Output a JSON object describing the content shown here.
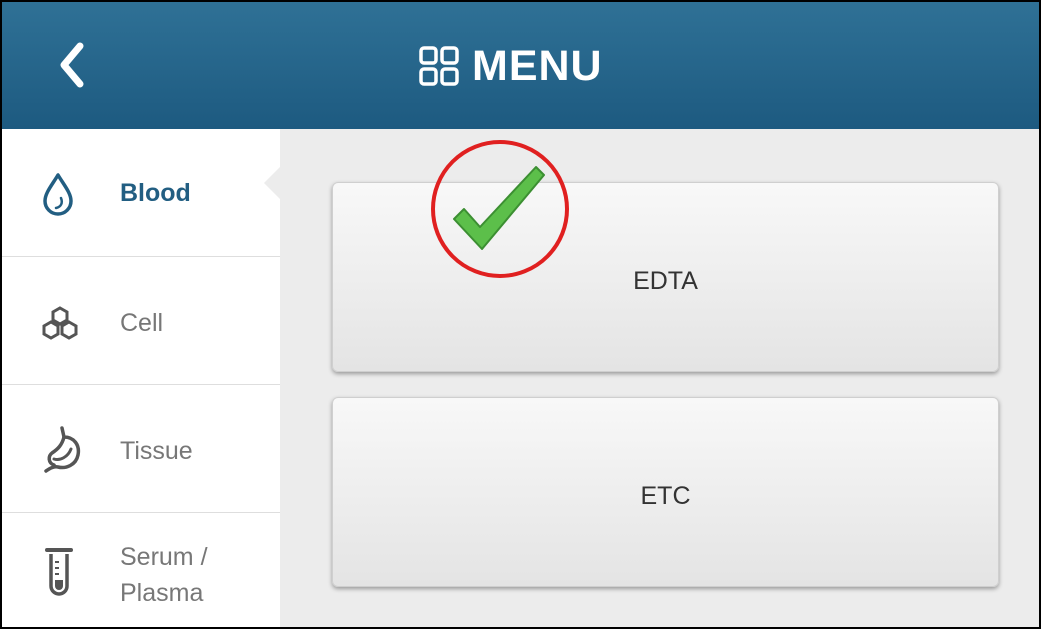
{
  "header": {
    "back_icon": "chevron-left-icon",
    "menu_icon": "grid-icon",
    "title": "MENU",
    "color": "#1f5e86"
  },
  "sidebar": {
    "items": [
      {
        "icon": "drop-icon",
        "label": "Blood",
        "active": true
      },
      {
        "icon": "cells-icon",
        "label": "Cell",
        "active": false
      },
      {
        "icon": "stomach-icon",
        "label": "Tissue",
        "active": false
      },
      {
        "icon": "test-tube-icon",
        "label_line1": "Serum /",
        "label_line2": "Plasma",
        "active": false
      }
    ],
    "active_color": "#225e82"
  },
  "options": [
    {
      "label": "EDTA",
      "selected": true
    },
    {
      "label": "ETC",
      "selected": false
    }
  ],
  "annotation": {
    "icon": "checkmark-icon",
    "circle_color": "#e02020",
    "check_color": "#5cbf4a"
  }
}
